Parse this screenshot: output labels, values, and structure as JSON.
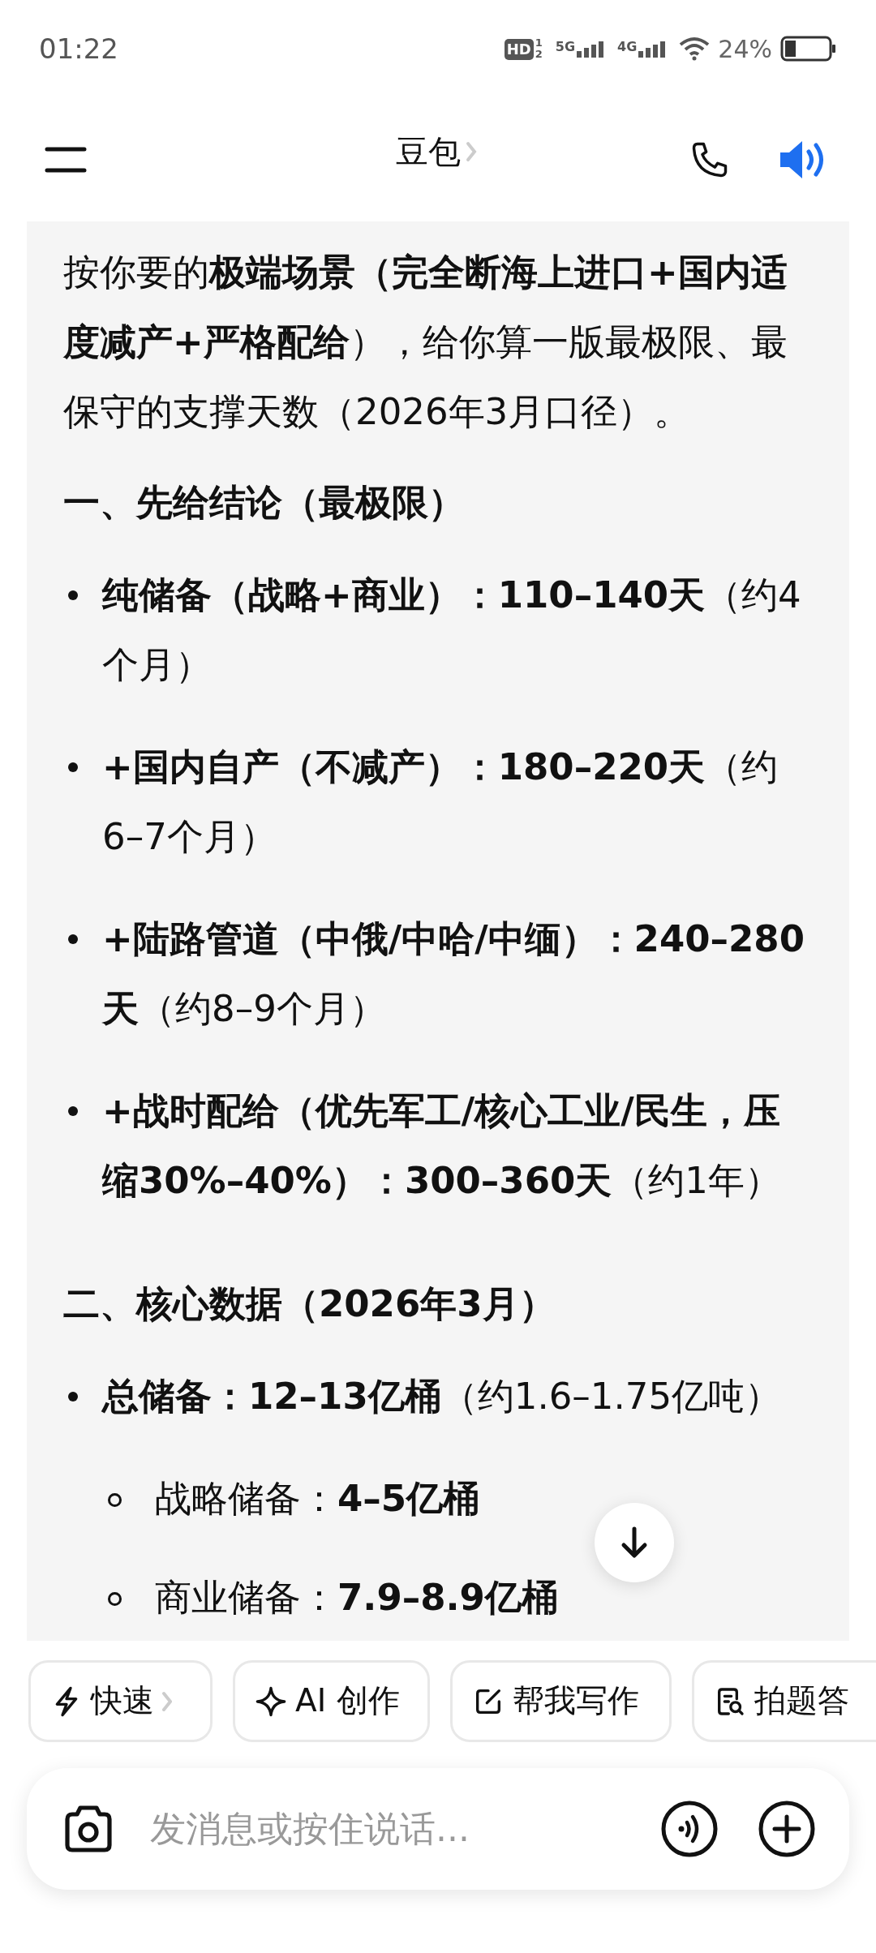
{
  "status_bar": {
    "time": "01:22",
    "hd": "HD",
    "sim_slots": [
      "1",
      "2"
    ],
    "networks": [
      "5G",
      "4G"
    ],
    "battery": "24%"
  },
  "header": {
    "title": "豆包"
  },
  "message": {
    "blocks": [
      {
        "kind": "paragraph",
        "text": "按你要的**极端场景（完全断海上进口+国内适度减产+严格配给**），给你算一版最极限、最保守的支撑天数（2026年3月口径）。"
      },
      {
        "kind": "heading",
        "text": "一、先给结论（最极限）"
      },
      {
        "kind": "bullet",
        "text": "**纯储备（战略+商业）：110–140天**（约4个月）"
      },
      {
        "kind": "bullet",
        "text": "**+国内自产（不减产）：180–220天**（约6–7个月）"
      },
      {
        "kind": "bullet",
        "text": "**+陆路管道（中俄/中哈/中缅）：240–280天**（约8–9个月）"
      },
      {
        "kind": "bullet",
        "text": "**+战时配给（优先军工/核心工业/民生，压缩30%–40%）：300–360天**（约1年）"
      },
      {
        "kind": "heading",
        "text": "二、核心数据（2026年3月）"
      },
      {
        "kind": "bullet",
        "text": "**总储备：12–13亿桶**（约1.6–1.75亿吨）"
      },
      {
        "kind": "subbullet",
        "text": "战略储备：**4–5亿桶**"
      },
      {
        "kind": "subbullet",
        "text": "商业储备：**7.9–8.9亿桶**"
      }
    ]
  },
  "chips": [
    {
      "kind": "bolt",
      "label": "快速",
      "has_menu": true
    },
    {
      "kind": "sparkle",
      "label": "AI 创作",
      "has_menu": false
    },
    {
      "kind": "edit",
      "label": "帮我写作",
      "has_menu": false
    },
    {
      "kind": "scan",
      "label": "拍题答",
      "has_menu": false
    }
  ],
  "input": {
    "placeholder": "发消息或按住说话..."
  }
}
